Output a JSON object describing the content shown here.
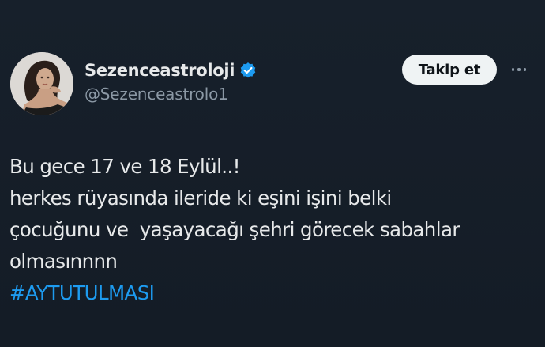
{
  "tweet": {
    "author": {
      "display_name": "Sezenceastroloji",
      "handle": "@Sezenceastrolo1",
      "verified": true,
      "avatar_icon": "profile-photo"
    },
    "follow_label": "Takip et",
    "more_icon": "ellipsis-icon",
    "text_lines": [
      "Bu gece 17 ve 18 Eylül..!",
      "herkes rüyasında ileride ki eşini işini belki",
      "çocuğunu ve  yaşayacağı şehri görecek sabahlar",
      "olmasınnnn"
    ],
    "hashtag": "#AYTUTULMASI"
  },
  "colors": {
    "background": "#15202b",
    "text": "#e7e9ea",
    "secondary_text": "#8b98a5",
    "link": "#1d9bf0",
    "verified_badge": "#1d9bf0",
    "follow_button_bg": "#eff3f4"
  }
}
